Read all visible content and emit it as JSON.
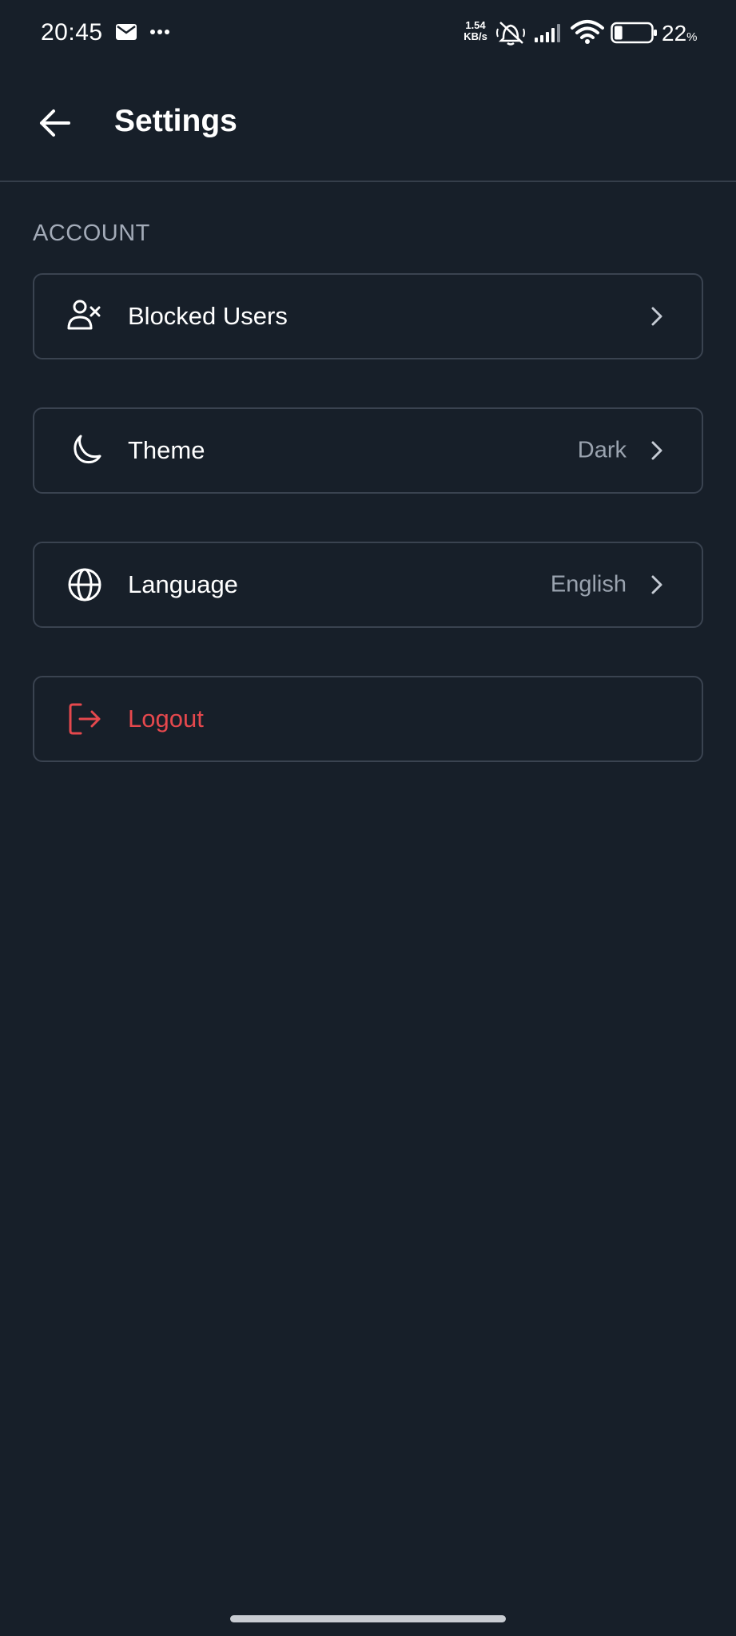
{
  "status_bar": {
    "time": "20:45",
    "net_speed_value": "1.54",
    "net_speed_unit": "KB/s",
    "battery_percent": "22",
    "battery_unit": "%",
    "battery_level": 0.22
  },
  "header": {
    "title": "Settings"
  },
  "section": {
    "label": "ACCOUNT"
  },
  "items": [
    {
      "label": "Blocked Users",
      "value": "",
      "icon": "user-x-icon"
    },
    {
      "label": "Theme",
      "value": "Dark",
      "icon": "moon-icon"
    },
    {
      "label": "Language",
      "value": "English",
      "icon": "globe-icon"
    },
    {
      "label": "Logout",
      "value": "",
      "icon": "logout-icon"
    }
  ],
  "colors": {
    "background": "#171f29",
    "border": "#3a4350",
    "danger": "#e5484d",
    "muted_text": "#9aa3af"
  }
}
